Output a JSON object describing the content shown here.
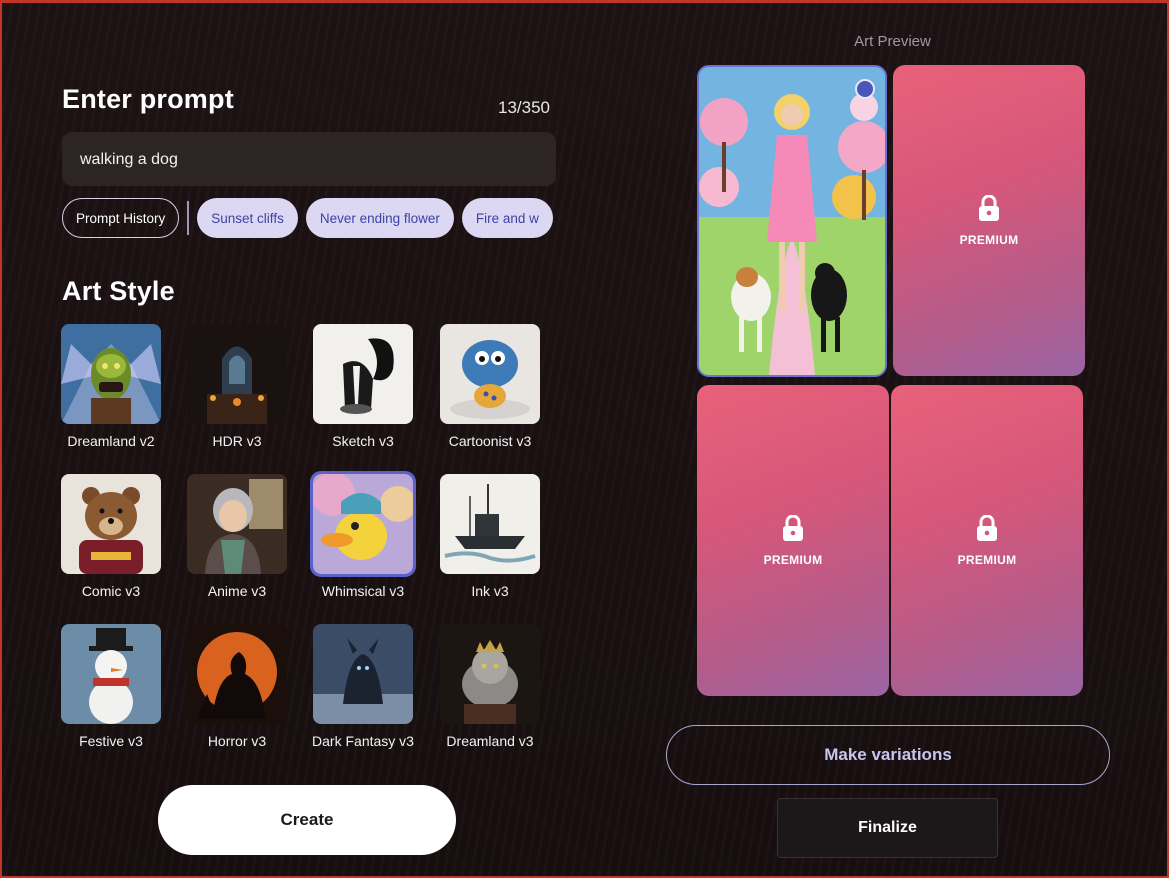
{
  "prompt": {
    "heading": "Enter prompt",
    "counter": "13/350",
    "value": "walking a dog"
  },
  "chips": {
    "history_label": "Prompt History",
    "suggestions": [
      "Sunset cliffs",
      "Never ending flower",
      "Fire and w"
    ]
  },
  "art_style": {
    "heading": "Art Style",
    "selected": "Whimsical v3",
    "items": [
      {
        "label": "Dreamland v2"
      },
      {
        "label": "HDR v3"
      },
      {
        "label": "Sketch v3"
      },
      {
        "label": "Cartoonist v3"
      },
      {
        "label": "Comic v3"
      },
      {
        "label": "Anime v3"
      },
      {
        "label": "Whimsical v3"
      },
      {
        "label": "Ink v3"
      },
      {
        "label": "Festive v3"
      },
      {
        "label": "Horror v3"
      },
      {
        "label": "Dark Fantasy v3"
      },
      {
        "label": "Dreamland v3"
      }
    ]
  },
  "create_label": "Create",
  "preview": {
    "title": "Art Preview",
    "premium_label": "PREMIUM",
    "variations_label": "Make variations",
    "finalize_label": "Finalize"
  },
  "colors": {
    "background": "#180f10",
    "accent": "#5b63c9",
    "chip_bg": "#dcd8f3",
    "chip_text": "#3d43a3",
    "premium_gradient_start": "#e9617a",
    "premium_gradient_end": "#9b64a4",
    "border": "#c2362a"
  },
  "icons": {
    "lock": "lock-icon",
    "select": "selection-indicator-icon"
  }
}
